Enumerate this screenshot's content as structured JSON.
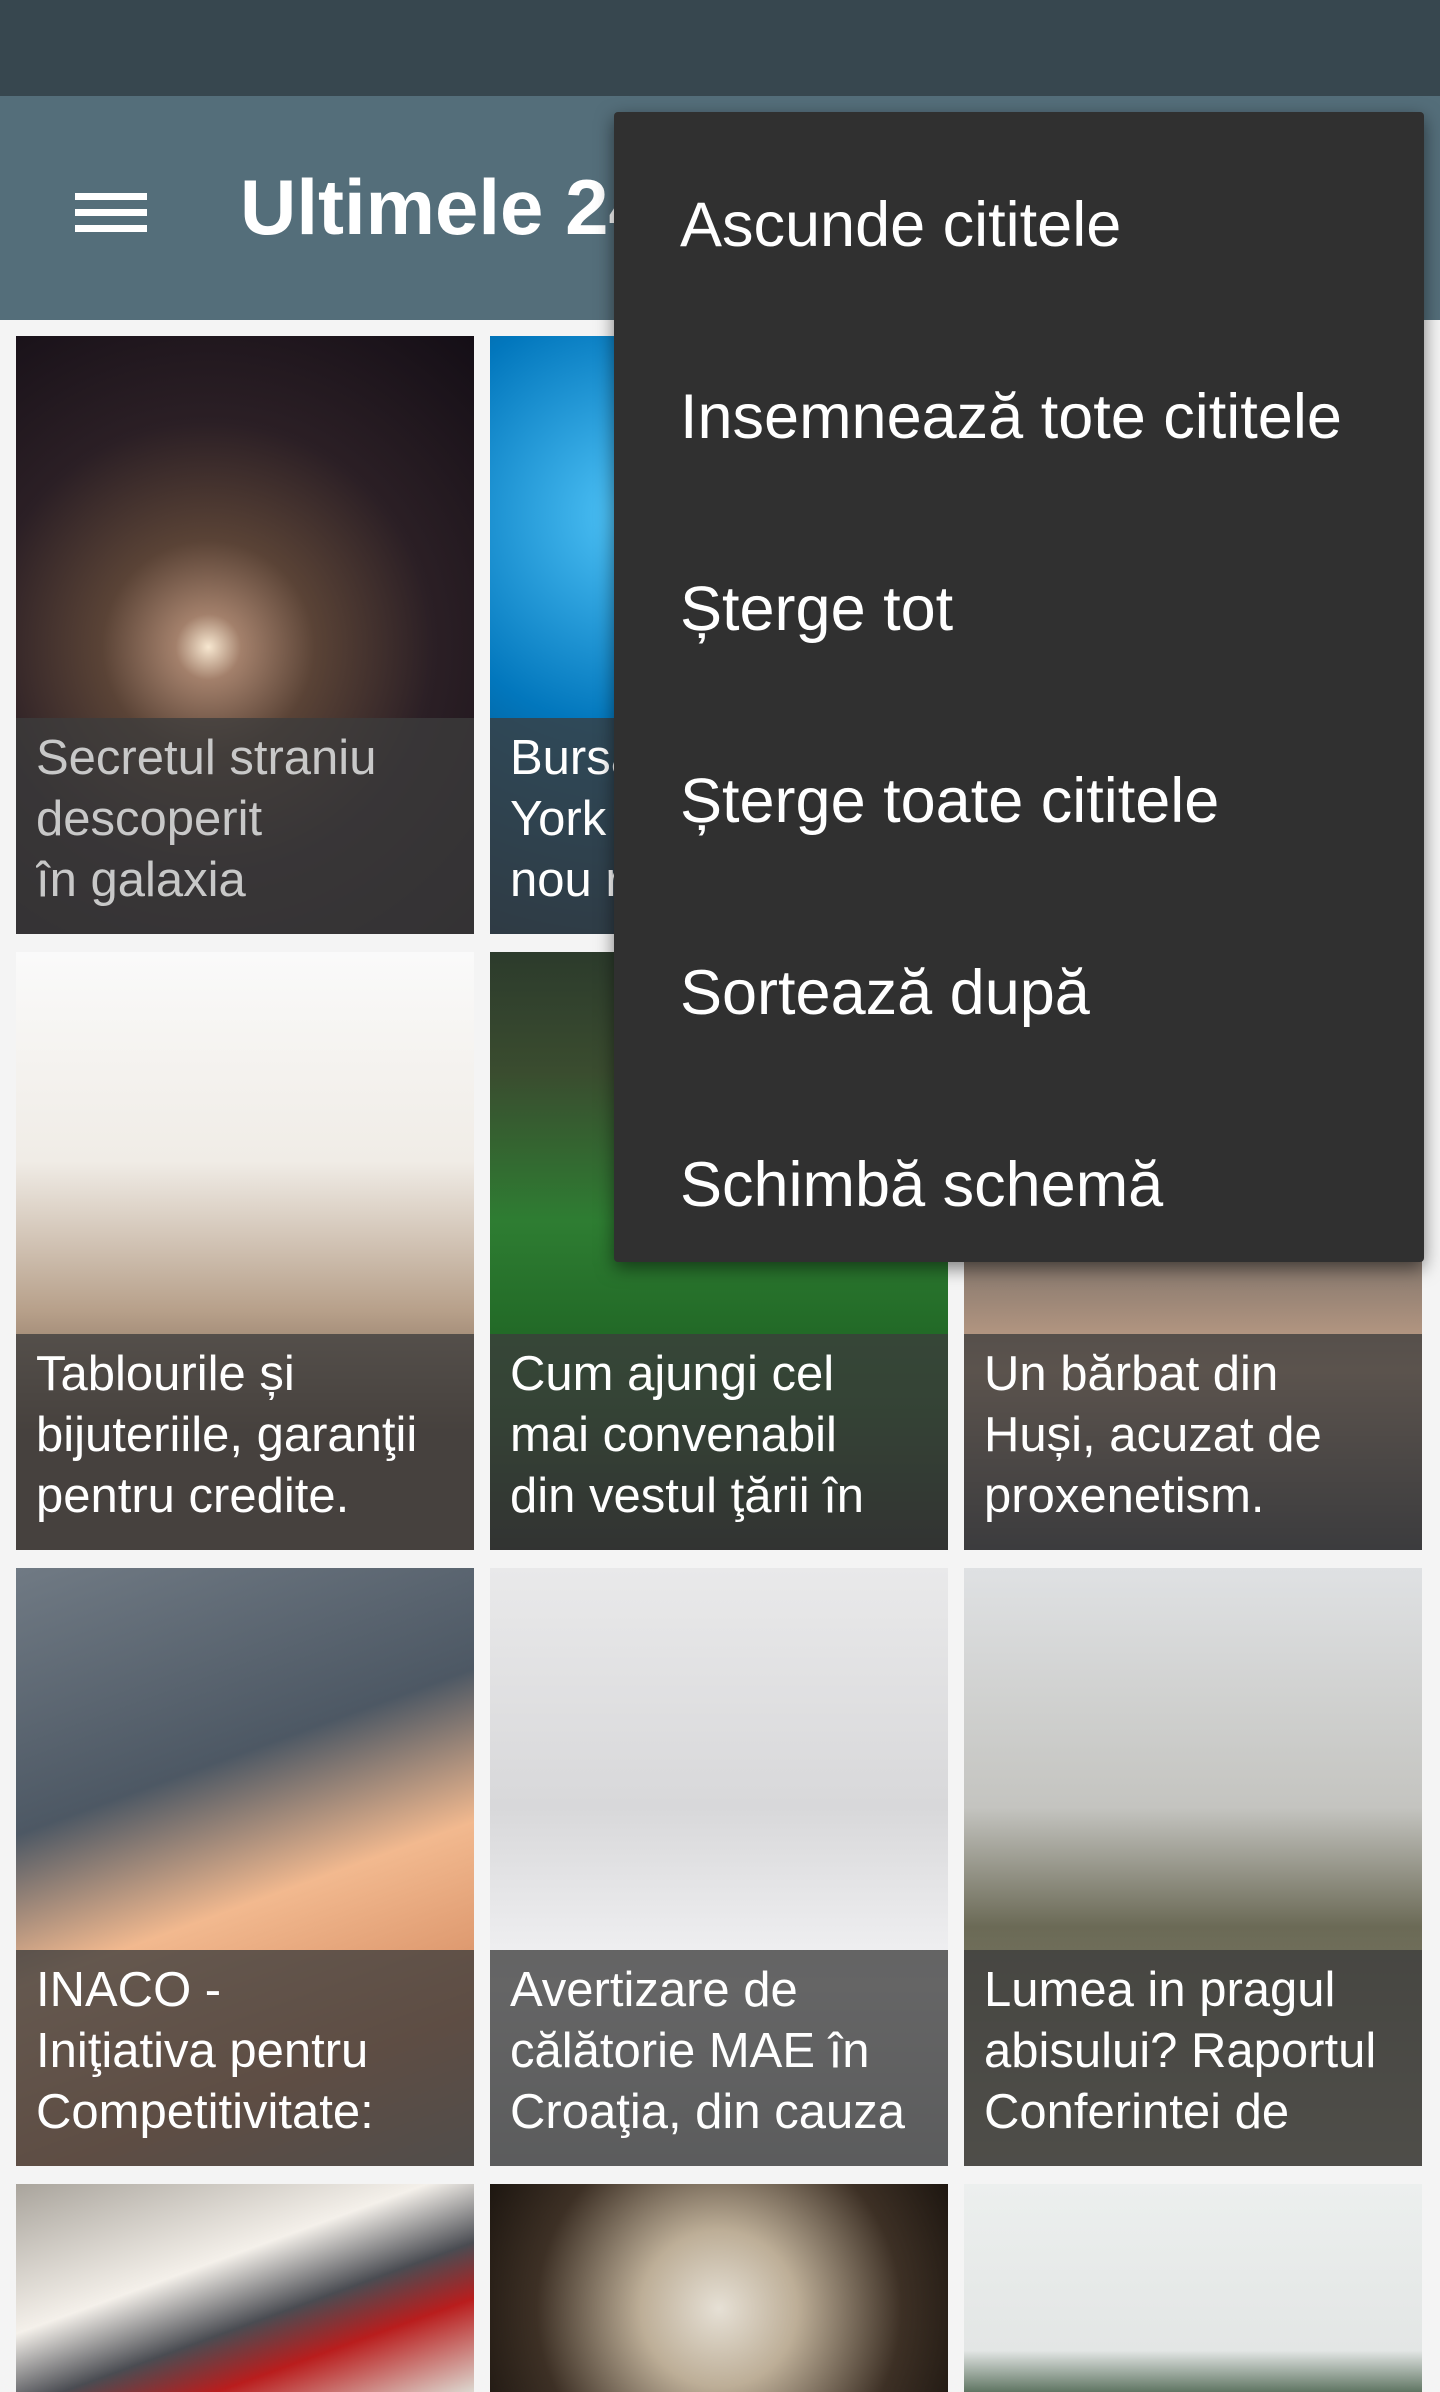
{
  "app_bar": {
    "title": "Ultimele 24 ore",
    "menu_icon": "hamburger-menu-icon"
  },
  "articles": [
    {
      "title_lines": [
        "Secretul straniu",
        "descoperit",
        "în galaxia"
      ],
      "image": "galaxy",
      "read": true
    },
    {
      "title_lines": [
        "Bursa de la New",
        "York are un",
        "nou record"
      ],
      "image": "globe",
      "read": false
    },
    {
      "title_lines": [
        "",
        "",
        ""
      ],
      "image": "sky",
      "read": false
    },
    {
      "title_lines": [
        "Tablourile și",
        "bijuteriile, garanţii",
        "pentru credite."
      ],
      "image": "sculptures",
      "read": false
    },
    {
      "title_lines": [
        "Cum ajungi cel",
        "mai convenabil",
        "din vestul ţării în"
      ],
      "image": "train",
      "read": false
    },
    {
      "title_lines": [
        "Un bărbat din",
        "Huși, acuzat de",
        "proxenetism."
      ],
      "image": "handcuffs",
      "read": false
    },
    {
      "title_lines": [
        "INACO -",
        "Iniţiativa pentru",
        "Competitivitate:"
      ],
      "image": "money",
      "read": false
    },
    {
      "title_lines": [
        "Avertizare de",
        "călătorie MAE în",
        "Croaţia, din cauza"
      ],
      "image": "snow",
      "read": false
    },
    {
      "title_lines": [
        "Lumea in pragul",
        "abisului? Raportul",
        "Conferintei de"
      ],
      "image": "missile",
      "read": false
    },
    {
      "title_lines": [
        "",
        "",
        ""
      ],
      "image": "police",
      "read": false
    },
    {
      "title_lines": [
        "",
        "",
        ""
      ],
      "image": "tunnel",
      "read": false
    },
    {
      "title_lines": [
        "",
        "",
        ""
      ],
      "image": "sky",
      "read": false
    }
  ],
  "overflow_menu": {
    "items": [
      "Ascunde cititele",
      "Insemnează tote cititele",
      "Șterge tot",
      "Șterge toate cititele",
      "Sortează după",
      "Schimbă schemă"
    ]
  },
  "colors": {
    "status_bar": "#37474f",
    "app_bar": "#546e7a",
    "menu_background": "#303030",
    "caption_overlay": "#3c3c3c"
  }
}
